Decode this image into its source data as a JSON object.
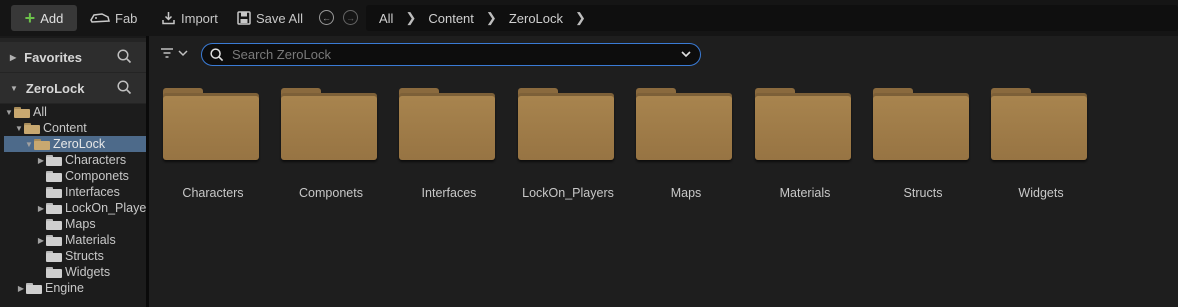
{
  "toolbar": {
    "add_label": "Add",
    "fab_label": "Fab",
    "import_label": "Import",
    "save_all_label": "Save All"
  },
  "breadcrumb": [
    "All",
    "Content",
    "ZeroLock"
  ],
  "sidebar": {
    "favorites_label": "Favorites",
    "project_label": "ZeroLock",
    "tree": [
      {
        "label": "All"
      },
      {
        "label": "Content"
      },
      {
        "label": "ZeroLock"
      },
      {
        "label": "Characters"
      },
      {
        "label": "Componets"
      },
      {
        "label": "Interfaces"
      },
      {
        "label": "LockOn_Players"
      },
      {
        "label": "Maps"
      },
      {
        "label": "Materials"
      },
      {
        "label": "Structs"
      },
      {
        "label": "Widgets"
      },
      {
        "label": "Engine"
      }
    ]
  },
  "search": {
    "placeholder": "Search ZeroLock"
  },
  "folders": [
    {
      "label": "Characters"
    },
    {
      "label": "Componets"
    },
    {
      "label": "Interfaces"
    },
    {
      "label": "LockOn_Players"
    },
    {
      "label": "Maps"
    },
    {
      "label": "Materials"
    },
    {
      "label": "Structs"
    },
    {
      "label": "Widgets"
    }
  ],
  "colors": {
    "accent": "#3a7bd5",
    "selected_row": "#4d6a8a",
    "folder": "#a8844e",
    "add_icon": "#6cc24a"
  },
  "icons": [
    "plus-icon",
    "fab-icon",
    "import-icon",
    "save-icon",
    "back-icon",
    "forward-icon",
    "chevron-right-icon",
    "search-icon",
    "filter-icon",
    "chevron-down-icon",
    "folder-icon"
  ]
}
